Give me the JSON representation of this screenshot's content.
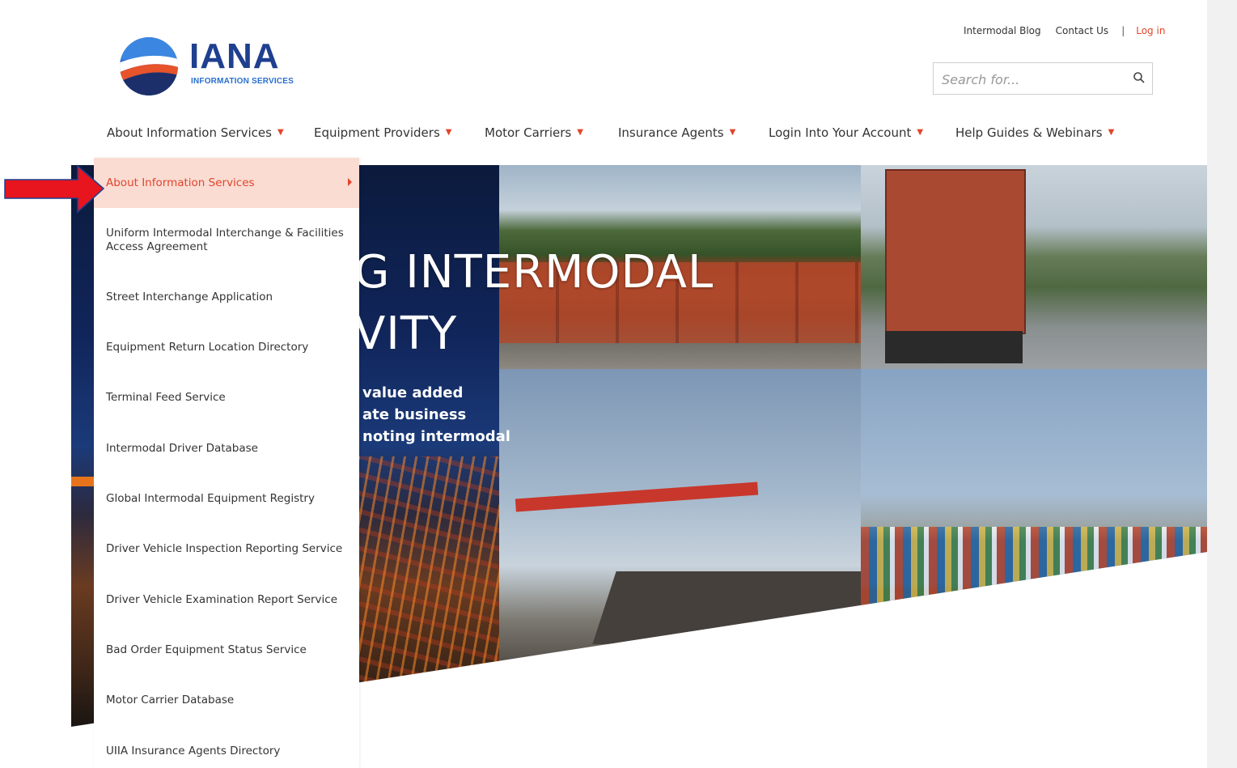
{
  "logo": {
    "word": "IANA",
    "subtitle": "INFORMATION SERVICES"
  },
  "top_links": {
    "blog": "Intermodal Blog",
    "contact": "Contact Us",
    "separator": "|",
    "login": "Log in"
  },
  "search": {
    "placeholder": "Search for..."
  },
  "nav": [
    {
      "label": "About Information Services"
    },
    {
      "label": "Equipment Providers"
    },
    {
      "label": "Motor Carriers"
    },
    {
      "label": "Insurance Agents"
    },
    {
      "label": "Login Into Your Account"
    },
    {
      "label": "Help Guides & Webinars"
    }
  ],
  "hero": {
    "line1": "G INTERMODAL",
    "line2": "VITY",
    "para": [
      "value added",
      "ate business",
      "noting intermodal"
    ]
  },
  "dropdown": {
    "active": "About Information Services",
    "items": [
      "Uniform Intermodal Interchange & Facilities Access Agreement",
      "Street Interchange Application",
      "Equipment Return Location Directory",
      "Terminal Feed Service",
      "Intermodal Driver Database",
      "Global Intermodal Equipment Registry",
      "Driver Vehicle Inspection Reporting Service",
      "Driver Vehicle Examination Report Service",
      "Bad Order Equipment Status Service",
      "Motor Carrier Database",
      "UIIA Insurance Agents Directory"
    ]
  },
  "colors": {
    "accent": "#e2452b",
    "active_bg": "#fadcd3",
    "logo_blue": "#1f3f8f",
    "annotation": "#e8141e"
  },
  "icons": {
    "search": "search-icon",
    "caret": "caret-down-icon",
    "submenu": "chevron-right-icon"
  }
}
